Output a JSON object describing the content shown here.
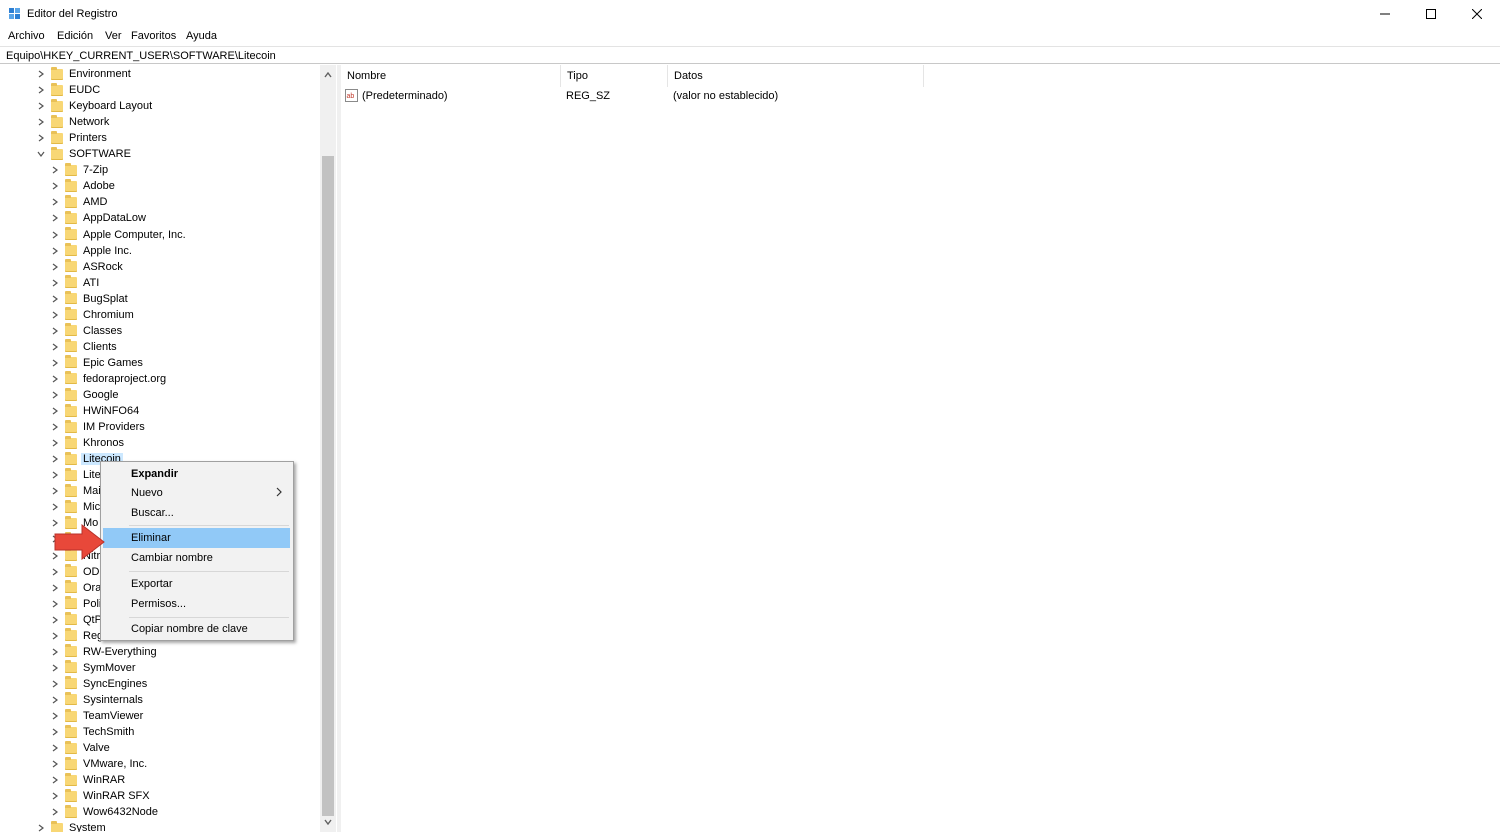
{
  "window": {
    "title": "Editor del Registro"
  },
  "menubar": [
    "Archivo",
    "Edición",
    "Ver",
    "Favoritos",
    "Ayuda"
  ],
  "address": "Equipo\\HKEY_CURRENT_USER\\SOFTWARE\\Litecoin",
  "tree": {
    "parent_items": [
      "Environment",
      "EUDC",
      "Keyboard Layout",
      "Network",
      "Printers",
      "SOFTWARE"
    ],
    "software_children": [
      "7-Zip",
      "Adobe",
      "AMD",
      "AppDataLow",
      "Apple Computer, Inc.",
      "Apple Inc.",
      "ASRock",
      "ATI",
      "BugSplat",
      "Chromium",
      "Classes",
      "Clients",
      "Epic Games",
      "fedoraproject.org",
      "Google",
      "HWiNFO64",
      "IM Providers",
      "Khronos",
      "Litecoin",
      "Lite",
      "Mai",
      "Mic",
      "Mo",
      "",
      "Nitr",
      "ODE",
      "Ora",
      "Poli",
      "QtP",
      "Reg",
      "RW-Everything",
      "SymMover",
      "SyncEngines",
      "Sysinternals",
      "TeamViewer",
      "TechSmith",
      "Valve",
      "VMware, Inc.",
      "WinRAR",
      "WinRAR SFX",
      "Wow6432Node"
    ],
    "last_item": "System",
    "selected": "Litecoin"
  },
  "list": {
    "headers": [
      "Nombre",
      "Tipo",
      "Datos"
    ],
    "rows": [
      {
        "name": "(Predeterminado)",
        "type": "REG_SZ",
        "data": "(valor no establecido)",
        "icon": "reg-sz-icon"
      }
    ]
  },
  "context_menu": {
    "items": [
      {
        "label": "Expandir",
        "bold": true
      },
      {
        "label": "Nuevo",
        "submenu": true
      },
      {
        "label": "Buscar..."
      },
      {
        "label": "Eliminar",
        "highlighted": true
      },
      {
        "label": "Cambiar nombre"
      },
      {
        "label": "Exportar"
      },
      {
        "label": "Permisos..."
      },
      {
        "label": "Copiar nombre de clave"
      }
    ]
  },
  "colors": {
    "selection": "#cce8ff",
    "menu_highlight": "#91c9f7",
    "folder": "#f8d775",
    "arrow": "#e8483a"
  }
}
